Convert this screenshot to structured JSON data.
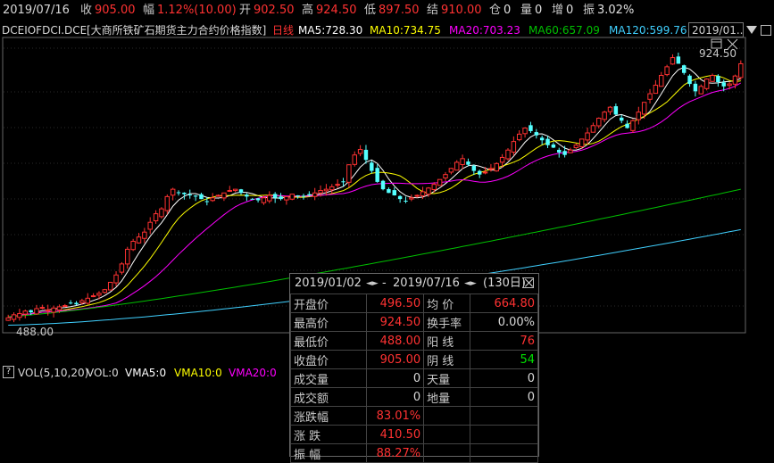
{
  "quote_bar": {
    "date": "2019/07/16",
    "close_label": "收",
    "close": "905.00",
    "change_label": "幅",
    "change": "1.12%(10.00)",
    "open_label": "开",
    "open": "902.50",
    "high_label": "高",
    "high": "924.50",
    "low_label": "低",
    "low": "897.50",
    "settle_label": "结",
    "settle": "910.00",
    "oi_label": "仓",
    "oi": "0",
    "vol_label": "量",
    "vol": "0",
    "inc_label": "增",
    "inc": "0",
    "amp_label": "振",
    "amp": "3.02%"
  },
  "ma_bar": {
    "symbol": "DCEIOFDCI.DCE",
    "name": "[大商所铁矿石期货主力合约价格指数]",
    "period": "日线",
    "ma5": "MA5:728.30",
    "ma10": "MA10:734.75",
    "ma20": "MA20:703.23",
    "ma60": "MA60:657.09",
    "ma120": "MA120:599.76",
    "date_box": "2019/01..."
  },
  "colors": {
    "up": "#ff3232",
    "down": "#54ffff",
    "ma5": "#ffffff",
    "ma10": "#ffff00",
    "ma20": "#ff00ff",
    "ma60": "#00c000",
    "ma120": "#40d0ff",
    "text": "#c8c8c8"
  },
  "chart_data": {
    "type": "candlestick",
    "x": "trading days 2019/01/02 - 2019/07/16",
    "y_range": [
      470,
      945
    ],
    "annotations": {
      "high_label": "924.50",
      "low_label": "488.00"
    },
    "closes": [
      490,
      495,
      497,
      501,
      499,
      505,
      507,
      503,
      506,
      508,
      510,
      514,
      512,
      518,
      522,
      526,
      530,
      536,
      548,
      560,
      578,
      602,
      615,
      622,
      630,
      646,
      660,
      668,
      688,
      700,
      695,
      692,
      690,
      688,
      684,
      680,
      686,
      690,
      694,
      698,
      700,
      694,
      688,
      684,
      682,
      686,
      690,
      686,
      684,
      688,
      692,
      690,
      688,
      692,
      694,
      698,
      700,
      704,
      708,
      712,
      740,
      756,
      765,
      748,
      730,
      712,
      700,
      694,
      690,
      684,
      680,
      686,
      690,
      696,
      702,
      708,
      716,
      724,
      734,
      744,
      750,
      740,
      730,
      724,
      728,
      734,
      742,
      752,
      764,
      778,
      790,
      800,
      795,
      788,
      780,
      772,
      768,
      760,
      756,
      764,
      772,
      782,
      792,
      804,
      816,
      826,
      834,
      822,
      812,
      800,
      812,
      826,
      842,
      856,
      870,
      886,
      900,
      915,
      905,
      890,
      872,
      860,
      868,
      880,
      886,
      875,
      868,
      872,
      885,
      905
    ],
    "series": [
      {
        "name": "MA5",
        "value": "728.30"
      },
      {
        "name": "MA10",
        "value": "734.75"
      },
      {
        "name": "MA20",
        "value": "703.23"
      },
      {
        "name": "MA60",
        "value": "657.09"
      },
      {
        "name": "MA120",
        "value": "599.76"
      }
    ]
  },
  "volume_bar": {
    "label": "VOL(5,10,20)",
    "vol": "VOL:0",
    "vma5": "VMA5:0",
    "vma10": "VMA10:0",
    "vma20": "VMA20:0"
  },
  "stats": {
    "range_start": "2019/01/02",
    "range_end": "2019/07/16",
    "dash": "-",
    "days": "(130日)",
    "rows": [
      {
        "k1": "开盘价",
        "v1": "496.50",
        "c1": "#ff3232",
        "k2": "均  价",
        "v2": "664.80",
        "c2": "#ff3232"
      },
      {
        "k1": "最高价",
        "v1": "924.50",
        "c1": "#ff3232",
        "k2": "换手率",
        "v2": "0.00%",
        "c2": "#d8d8d8"
      },
      {
        "k1": "最低价",
        "v1": "488.00",
        "c1": "#ff3232",
        "k2": "阳  线",
        "v2": "76",
        "c2": "#ff3232"
      },
      {
        "k1": "收盘价",
        "v1": "905.00",
        "c1": "#ff3232",
        "k2": "阴  线",
        "v2": "54",
        "c2": "#00e000"
      },
      {
        "k1": "成交量",
        "v1": "0",
        "c1": "#d8d8d8",
        "k2": "天量",
        "v2": "0",
        "c2": "#d8d8d8"
      },
      {
        "k1": "成交额",
        "v1": "0",
        "c1": "#d8d8d8",
        "k2": "地量",
        "v2": "0",
        "c2": "#d8d8d8"
      },
      {
        "k1": "涨跌幅",
        "v1": "83.01%",
        "c1": "#ff3232",
        "k2": "",
        "v2": "",
        "c2": "#d8d8d8"
      },
      {
        "k1": "涨  跌",
        "v1": "410.50",
        "c1": "#ff3232",
        "k2": "",
        "v2": "",
        "c2": "#d8d8d8"
      },
      {
        "k1": "振  幅",
        "v1": "88.27%",
        "c1": "#ff3232",
        "k2": "",
        "v2": "",
        "c2": "#d8d8d8"
      }
    ]
  }
}
